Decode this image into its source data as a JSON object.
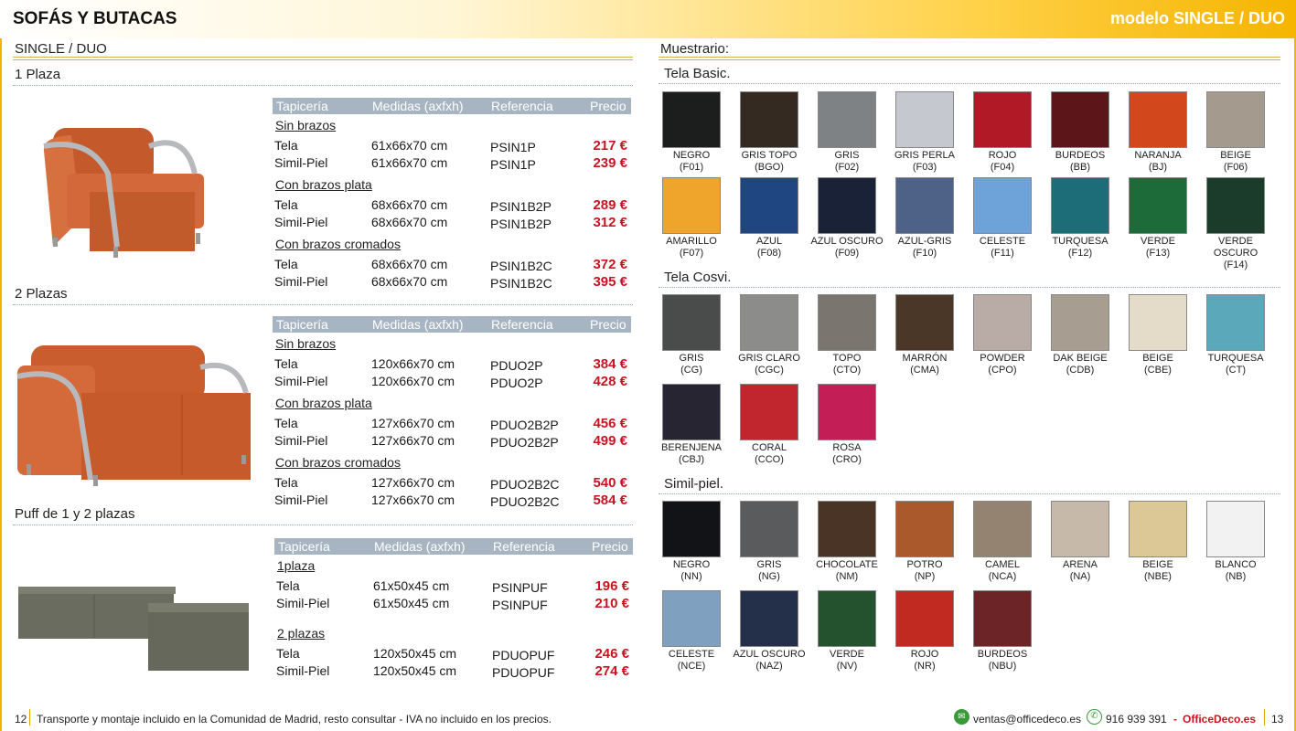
{
  "header": {
    "title": "SOFÁS Y BUTACAS",
    "model": "modelo SINGLE / DUO"
  },
  "left": {
    "section_title": "SINGLE / DUO",
    "table_header": {
      "c1": "Tapicería",
      "c2": "Medidas (axfxh)",
      "c3": "Referencia",
      "c4": "Precio"
    },
    "blocks": [
      {
        "title": "1 Plaza",
        "groups": [
          {
            "name": "Sin brazos",
            "rows": [
              [
                "Tela",
                "61x66x70 cm",
                "PSIN1P",
                "217 €"
              ],
              [
                "Simil-Piel",
                "61x66x70 cm",
                "PSIN1P",
                "239 €"
              ]
            ]
          },
          {
            "name": "Con brazos plata",
            "rows": [
              [
                "Tela",
                "68x66x70 cm",
                "PSIN1B2P",
                "289 €"
              ],
              [
                "Simil-Piel",
                "68x66x70 cm",
                "PSIN1B2P",
                "312 €"
              ]
            ]
          },
          {
            "name": "Con brazos cromados",
            "rows": [
              [
                "Tela",
                "68x66x70 cm",
                "PSIN1B2C",
                "372 €"
              ],
              [
                "Simil-Piel",
                "68x66x70 cm",
                "PSIN1B2C",
                "395 €"
              ]
            ]
          }
        ]
      },
      {
        "title": "2 Plazas",
        "groups": [
          {
            "name": "Sin brazos",
            "rows": [
              [
                "Tela",
                "120x66x70 cm",
                "PDUO2P",
                "384 €"
              ],
              [
                "Simil-Piel",
                "120x66x70 cm",
                "PDUO2P",
                "428 €"
              ]
            ]
          },
          {
            "name": "Con brazos plata",
            "rows": [
              [
                "Tela",
                "127x66x70 cm",
                "PDUO2B2P",
                "456 €"
              ],
              [
                "Simil-Piel",
                "127x66x70 cm",
                "PDUO2B2P",
                "499 €"
              ]
            ]
          },
          {
            "name": "Con brazos cromados",
            "rows": [
              [
                "Tela",
                "127x66x70 cm",
                "PDUO2B2C",
                "540 €"
              ],
              [
                "Simil-Piel",
                "127x66x70 cm",
                "PDUO2B2C",
                "584 €"
              ]
            ]
          }
        ]
      },
      {
        "title": "Puff de 1 y 2 plazas",
        "groups": [
          {
            "name": "1plaza",
            "rows": [
              [
                "Tela",
                "61x50x45 cm",
                "PSINPUF",
                "196 €"
              ],
              [
                "Simil-Piel",
                "61x50x45 cm",
                "PSINPUF",
                "210 €"
              ]
            ]
          },
          {
            "name": "2 plazas",
            "rows": [
              [
                "Tela",
                "120x50x45 cm",
                "PDUOPUF",
                "246 €"
              ],
              [
                "Simil-Piel",
                "120x50x45 cm",
                "PDUOPUF",
                "274 €"
              ]
            ]
          }
        ]
      }
    ]
  },
  "right": {
    "title": "Muestrario:",
    "sections": [
      {
        "title": "Tela Basic.",
        "swatches": [
          {
            "name": "NEGRO",
            "code": "(F01)",
            "color": "#1c1e1e"
          },
          {
            "name": "GRIS TOPO",
            "code": "(BGO)",
            "color": "#352a22"
          },
          {
            "name": "GRIS",
            "code": "(F02)",
            "color": "#7f8285"
          },
          {
            "name": "GRIS PERLA",
            "code": "(F03)",
            "color": "#c6c8cf"
          },
          {
            "name": "ROJO",
            "code": "(F04)",
            "color": "#b01925"
          },
          {
            "name": "BURDEOS",
            "code": "(BB)",
            "color": "#5c1518"
          },
          {
            "name": "NARANJA",
            "code": "(BJ)",
            "color": "#d2471b"
          },
          {
            "name": "BEIGE",
            "code": "(F06)",
            "color": "#a59a8e"
          },
          {
            "name": "AMARILLO",
            "code": "(F07)",
            "color": "#efa52c"
          },
          {
            "name": "AZUL",
            "code": "(F08)",
            "color": "#1f4680"
          },
          {
            "name": "AZUL OSCURO",
            "code": "(F09)",
            "color": "#1a2238"
          },
          {
            "name": "AZUL-GRIS",
            "code": "(F10)",
            "color": "#4e6187"
          },
          {
            "name": "CELESTE",
            "code": "(F11)",
            "color": "#6ea3da"
          },
          {
            "name": "TURQUESA",
            "code": "(F12)",
            "color": "#1c6d77"
          },
          {
            "name": "VERDE",
            "code": "(F13)",
            "color": "#1e6b3a"
          },
          {
            "name": "VERDE OSCURO",
            "code": "(F14)",
            "color": "#1b3c2b"
          }
        ]
      },
      {
        "title": "Tela Cosvi.",
        "swatches": [
          {
            "name": "GRIS",
            "code": "(CG)",
            "color": "#4a4b4b"
          },
          {
            "name": "GRIS CLARO",
            "code": "(CGC)",
            "color": "#8c8c8a"
          },
          {
            "name": "TOPO",
            "code": "(CTO)",
            "color": "#7b7570"
          },
          {
            "name": "MARRÓN",
            "code": "(CMA)",
            "color": "#4b3727"
          },
          {
            "name": "POWDER",
            "code": "(CPO)",
            "color": "#b9aca6"
          },
          {
            "name": "DAK BEIGE",
            "code": "(CDB)",
            "color": "#a79e91"
          },
          {
            "name": "BEIGE",
            "code": "(CBE)",
            "color": "#e4dcc8"
          },
          {
            "name": "TURQUESA",
            "code": "(CT)",
            "color": "#5ba8ba"
          },
          {
            "name": "BERENJENA",
            "code": "(CBJ)",
            "color": "#282532"
          },
          {
            "name": "CORAL",
            "code": "(CCO)",
            "color": "#c1262e"
          },
          {
            "name": "ROSA",
            "code": "(CRO)",
            "color": "#c31e55"
          }
        ]
      },
      {
        "title": "Simil-piel.",
        "swatches": [
          {
            "name": "NEGRO",
            "code": "(NN)",
            "color": "#111316"
          },
          {
            "name": "GRIS",
            "code": "(NG)",
            "color": "#595b5c"
          },
          {
            "name": "CHOCOLATE",
            "code": "(NM)",
            "color": "#4a3426"
          },
          {
            "name": "POTRO",
            "code": "(NP)",
            "color": "#a9592c"
          },
          {
            "name": "CAMEL",
            "code": "(NCA)",
            "color": "#948371"
          },
          {
            "name": "ARENA",
            "code": "(NA)",
            "color": "#c6b9aa"
          },
          {
            "name": "BEIGE",
            "code": "(NBE)",
            "color": "#dcc797"
          },
          {
            "name": "BLANCO",
            "code": "(NB)",
            "color": "#f2f2f2"
          },
          {
            "name": "CELESTE",
            "code": "(NCE)",
            "color": "#7fa0bf"
          },
          {
            "name": "AZUL OSCURO",
            "code": "(NAZ)",
            "color": "#24304a"
          },
          {
            "name": "VERDE",
            "code": "(NV)",
            "color": "#25522e"
          },
          {
            "name": "ROJO",
            "code": "(NR)",
            "color": "#c12a20"
          },
          {
            "name": "BURDEOS",
            "code": "(NBU)",
            "color": "#6c2426"
          }
        ]
      }
    ]
  },
  "footer": {
    "page_left": "12",
    "note": "Transporte y montaje incluido en la Comunidad de Madrid, resto consultar - IVA no incluido en los precios.",
    "email": "ventas@officedeco.es",
    "phone": "916 939 391",
    "separator": "-",
    "brand": "OfficeDeco.es",
    "page_right": "13"
  }
}
